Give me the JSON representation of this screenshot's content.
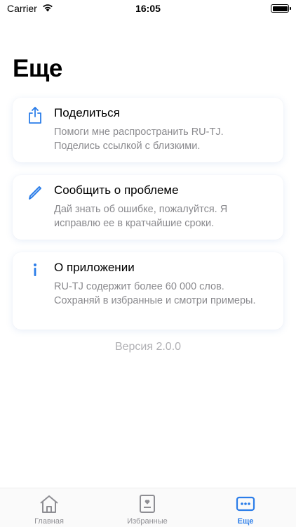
{
  "status": {
    "carrier": "Carrier",
    "time": "16:05"
  },
  "page_title": "Еще",
  "cards": [
    {
      "icon": "share-icon",
      "title": "Поделиться",
      "description": "Помоги мне распространить RU-TJ. Поделись ссылкой с близкими."
    },
    {
      "icon": "pencil-icon",
      "title": "Сообщить о проблеме",
      "description": "Дай знать об ошибке, пожалуйтся. Я исправлю ее в кратчайшие сроки."
    },
    {
      "icon": "info-icon",
      "title": "О приложении",
      "description": "RU-TJ содержит более 60 000 слов. Сохраняй в избранные и смотри примеры."
    }
  ],
  "version": "Версия 2.0.0",
  "tabs": [
    {
      "label": "Главная",
      "icon": "home-icon",
      "active": false
    },
    {
      "label": "Избранные",
      "icon": "favorites-icon",
      "active": false
    },
    {
      "label": "Еще",
      "icon": "more-icon",
      "active": true
    }
  ],
  "colors": {
    "accent": "#2b7de9",
    "secondary_text": "#8a8a8e",
    "inactive_tab": "#8e8e93"
  }
}
